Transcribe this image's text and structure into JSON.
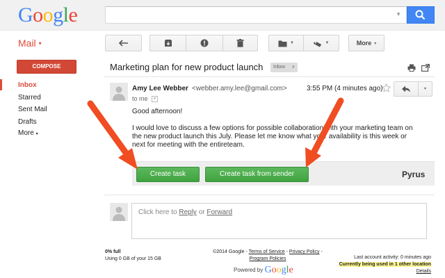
{
  "header": {
    "logo_letters": [
      {
        "char": "G",
        "color": "#4285f4"
      },
      {
        "char": "o",
        "color": "#ea4335"
      },
      {
        "char": "o",
        "color": "#fbbc05"
      },
      {
        "char": "g",
        "color": "#4285f4"
      },
      {
        "char": "l",
        "color": "#34a853"
      },
      {
        "char": "e",
        "color": "#ea4335"
      }
    ],
    "search_value": "",
    "search_icon": "search-icon"
  },
  "toolbar": {
    "mail_label": "Mail",
    "mail_caret": "▾",
    "more_label": "More",
    "more_caret": "▾",
    "icons": [
      "back-icon",
      "archive-icon",
      "report-spam-icon",
      "delete-icon",
      "folder-icon",
      "label-icon"
    ]
  },
  "sidebar": {
    "compose_label": "COMPOSE",
    "items": [
      {
        "label": "Inbox",
        "active": true
      },
      {
        "label": "Starred"
      },
      {
        "label": "Sent Mail"
      },
      {
        "label": "Drafts"
      },
      {
        "label": "More",
        "caret": "▾"
      }
    ]
  },
  "message": {
    "subject": "Marketing plan for new product launch",
    "tag_label": "Inbox",
    "tag_close": "x",
    "sender_name": "Amy Lee Webber",
    "sender_email": "<webber.amy.lee@gmail.com>",
    "time": "3:55 PM (4 minutes ago)",
    "to_me": "to me",
    "to_me_caret": "▾",
    "reply_caret": "▾",
    "greeting": "Good afternoon!",
    "body": "I would love to discuss a few options for possible collaboration with your marketing team on the new product launch this July. Please let me know what your availability is this week or next for meeting with the entireteam."
  },
  "pyrus": {
    "create_task_label": "Create task",
    "create_task_from_sender_label": "Create task from sender",
    "brand_label": "Pyrus"
  },
  "reply_box": {
    "prefix": "Click here to ",
    "reply_link": "Reply",
    "middle": " or ",
    "forward_link": "Forward"
  },
  "footer": {
    "storage_percent": "0% full",
    "storage_usage": "Using 0 GB of your 15 GB",
    "copyright": "©2014 Google - ",
    "terms_link": "Terms of Service",
    "dash1": " - ",
    "privacy_link": "Privacy Policy",
    "dash2": " - ",
    "program_link": "Program Policies",
    "powered_by": "Powered by",
    "powered_logo": "Google",
    "last_activity": "Last account activity: 0 minutes ago",
    "current_use": "Currently being used in 1 other location",
    "details_link": "Details"
  },
  "annotations": {
    "arrow_color": "#f04d23"
  }
}
